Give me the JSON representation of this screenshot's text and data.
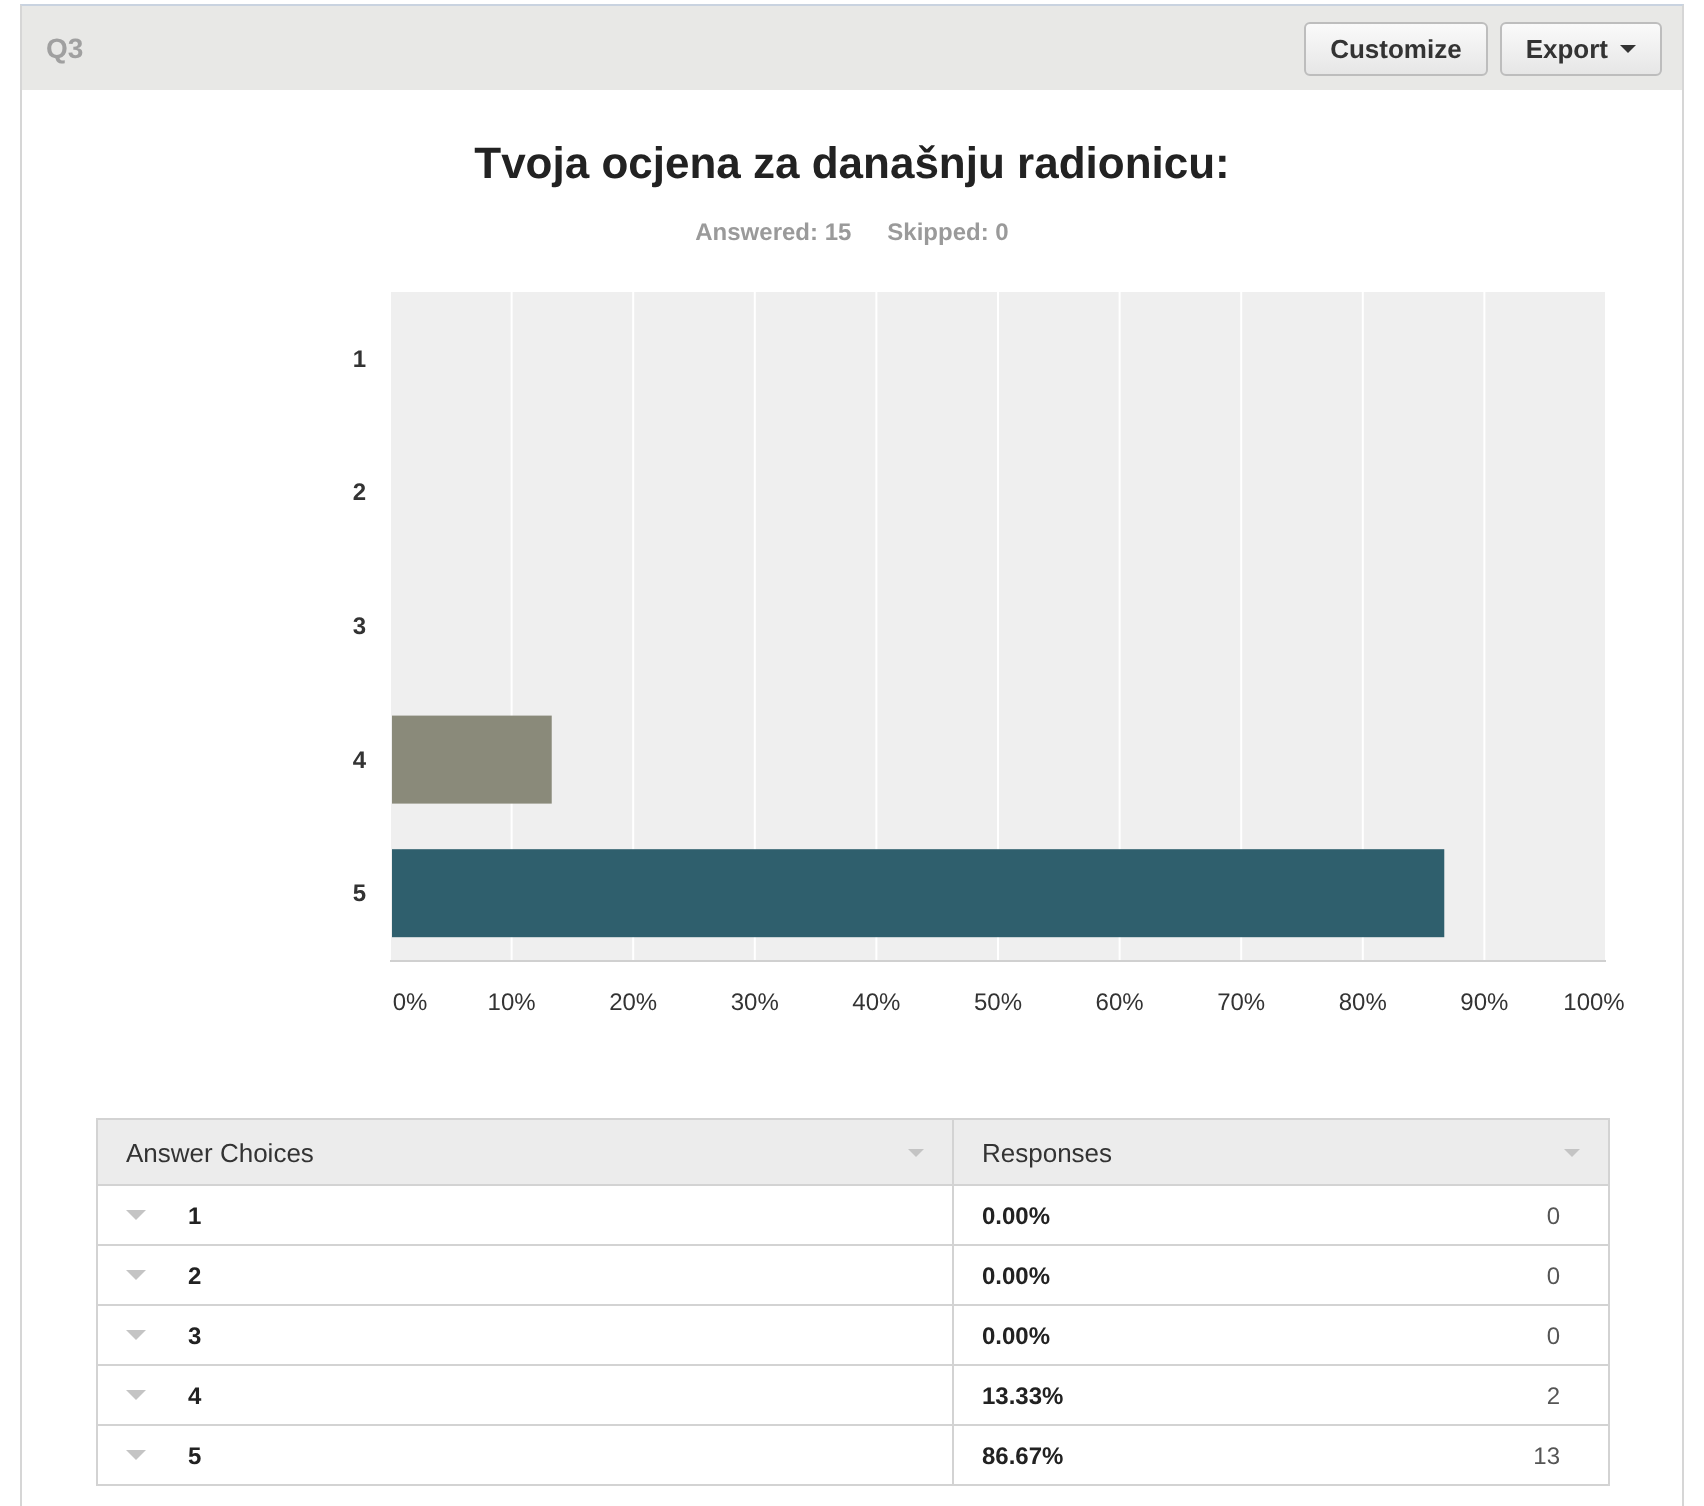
{
  "question": {
    "label": "Q3",
    "buttons": [
      {
        "label": "Customize",
        "kind": "plain"
      },
      {
        "label": "Export",
        "kind": "dropdown"
      }
    ]
  },
  "title": "Tvoja ocjena za današnju radionicu:",
  "stats": [
    "Answered: 15",
    "Skipped: 0"
  ],
  "chart": {
    "chart_data": {
      "type": "bar",
      "orientation": "horizontal",
      "categories": [
        "1",
        "2",
        "3",
        "4",
        "5"
      ],
      "series": [
        {
          "color": "#8a8a7a",
          "values": [
            null,
            null,
            null,
            13.3,
            null
          ]
        },
        {
          "color": "#2f5f6d",
          "values": [
            null,
            null,
            null,
            null,
            86.7
          ]
        }
      ],
      "grid": true,
      "xlim": [
        0,
        100
      ],
      "xticks": [
        {
          "value": 0,
          "label": "0%"
        },
        {
          "value": 10,
          "label": "10%"
        },
        {
          "value": 20,
          "label": "20%"
        },
        {
          "value": 30,
          "label": "30%"
        },
        {
          "value": 40,
          "label": "40%"
        },
        {
          "value": 50,
          "label": "50%"
        },
        {
          "value": 60,
          "label": "60%"
        },
        {
          "value": 70,
          "label": "70%"
        },
        {
          "value": 80,
          "label": "80%"
        },
        {
          "value": 90,
          "label": "90%"
        },
        {
          "value": 100,
          "label": "100%"
        }
      ]
    }
  },
  "table": {
    "columns": [
      "Answer Choices",
      "Responses"
    ],
    "rows": [
      {
        "choice": "1",
        "percent": "0.00%",
        "count": "0"
      },
      {
        "choice": "2",
        "percent": "0.00%",
        "count": "0"
      },
      {
        "choice": "3",
        "percent": "0.00%",
        "count": "0"
      },
      {
        "choice": "4",
        "percent": "13.33%",
        "count": "2"
      },
      {
        "choice": "5",
        "percent": "86.67%",
        "count": "13"
      }
    ]
  }
}
